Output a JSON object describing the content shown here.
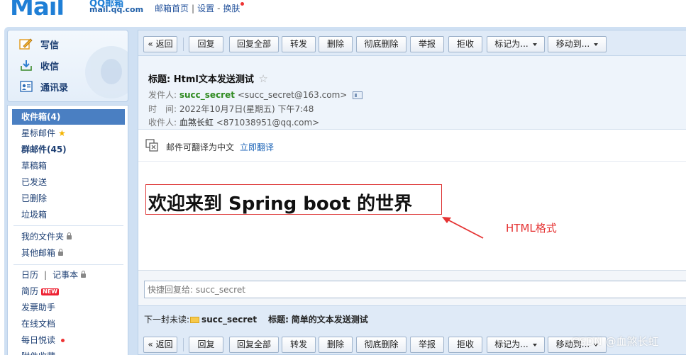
{
  "header": {
    "logo_text": "Mail",
    "logo_qq": "QQ邮箱",
    "logo_url": "mail.qq.com",
    "links": [
      "邮箱首页",
      "设置",
      "换肤"
    ]
  },
  "sidebar": {
    "actions": [
      {
        "label": "写信",
        "icon": "compose-icon"
      },
      {
        "label": "收信",
        "icon": "inbox-download-icon"
      },
      {
        "label": "通讯录",
        "icon": "contacts-icon"
      }
    ],
    "folders": [
      {
        "label": "收件箱(4)",
        "active": true
      },
      {
        "label": "星标邮件"
      },
      {
        "label": "群邮件(45)"
      },
      {
        "label": "草稿箱"
      },
      {
        "label": "已发送"
      },
      {
        "label": "已删除"
      },
      {
        "label": "垃圾箱"
      }
    ],
    "extras": [
      {
        "label": "我的文件夹"
      },
      {
        "label": "其他邮箱"
      }
    ],
    "apps": [
      {
        "label": "日历"
      },
      {
        "label": "记事本"
      },
      {
        "label": "简历",
        "badge": "NEW"
      },
      {
        "label": "发票助手"
      },
      {
        "label": "在线文档"
      },
      {
        "label": "每日悦读"
      },
      {
        "label": "附件收藏"
      }
    ]
  },
  "toolbar": {
    "buttons": [
      "« 返回",
      "回复",
      "回复全部",
      "转发",
      "删除",
      "彻底删除",
      "举报",
      "拒收",
      "标记为...",
      "移动到..."
    ]
  },
  "mail": {
    "subject_label": "标题:",
    "subject": "Html文本发送测试",
    "from_label": "发件人:",
    "from_name": "succ_secret",
    "from_addr": "<succ_secret@163.com>",
    "time_label": "时　间:",
    "time": "2022年10月7日(星期五) 下午7:48",
    "to_label": "收件人:",
    "to_name": "血煞长虹",
    "to_addr": "<871038951@qq.com>"
  },
  "translate": {
    "text": "邮件可翻译为中文",
    "link": "立即翻译"
  },
  "content": {
    "heading": "欢迎来到 Spring boot 的世界",
    "annotation": "HTML格式"
  },
  "reply": {
    "placeholder": "快捷回复给: succ_secret"
  },
  "next_unread": {
    "label": "下一封未读:",
    "sender": "succ_secret",
    "subject_label": "标题:",
    "subject": "简单的文本发送测试"
  },
  "colors": {
    "accent": "#4a7fc2",
    "frame": "#cfe0f3",
    "annotation": "#e53333"
  },
  "watermark": "CSDN @血煞长虹"
}
